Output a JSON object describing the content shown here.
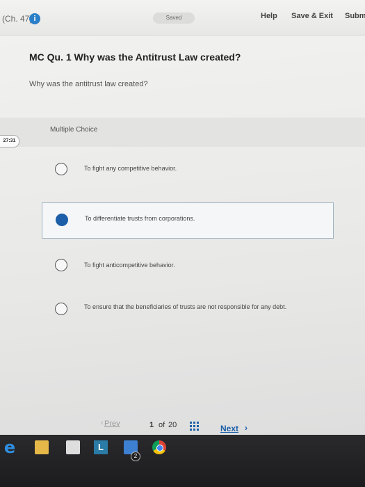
{
  "header": {
    "chapter": "(Ch. 47)",
    "info_icon": "i",
    "saved": "Saved",
    "help": "Help",
    "save_exit": "Save & Exit",
    "submit": "Subm"
  },
  "question": {
    "title": "MC Qu. 1 Why was the Antitrust Law created?",
    "prompt": "Why was the antitrust law created?",
    "type_label": "Multiple Choice",
    "timer": "27:31"
  },
  "options": [
    {
      "text": "To fight any competitive behavior.",
      "selected": false
    },
    {
      "text": "To differentiate trusts from corporations.",
      "selected": true
    },
    {
      "text": "To fight anticompetitive behavior.",
      "selected": false
    },
    {
      "text": "To ensure that the beneficiaries of trusts are not responsible for any debt.",
      "selected": false
    }
  ],
  "footer": {
    "prev": "Prev",
    "current_page": "1",
    "of": "of",
    "total_pages": "20",
    "next": "Next"
  },
  "taskbar": {
    "l_label": "L",
    "mail_badge": "2"
  },
  "colors": {
    "accent": "#1c5fa8",
    "info": "#2b7fc9"
  }
}
